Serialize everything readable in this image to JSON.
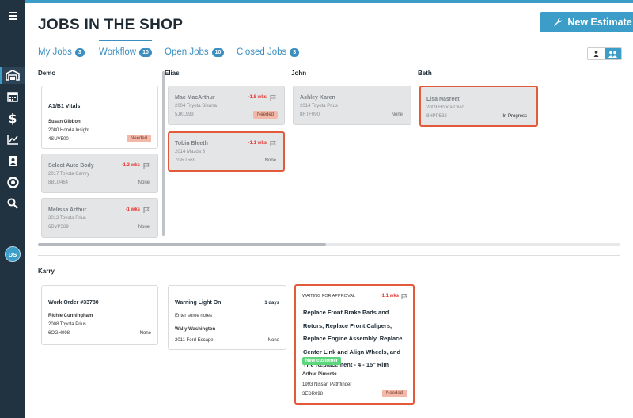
{
  "page": {
    "title": "JOBS IN THE SHOP"
  },
  "header": {
    "new_estimate_label": "New Estimate"
  },
  "tabs": [
    {
      "label": "My Jobs",
      "count": "3"
    },
    {
      "label": "Workflow",
      "count": "10"
    },
    {
      "label": "Open Jobs",
      "count": "10"
    },
    {
      "label": "Closed Jobs",
      "count": "3"
    }
  ],
  "user": {
    "initials": "DS"
  },
  "sidebar": {
    "icons": [
      "menu-icon",
      "shop-icon",
      "calendar-icon",
      "dollar-icon",
      "chart-icon",
      "contacts-icon",
      "support-icon",
      "search-icon"
    ]
  },
  "colors": {
    "accent": "#3b9dc8",
    "highlight": "#e35a3b",
    "overdue": "#e3342f",
    "needed_bg": "#f2b9a9",
    "new_customer": "#5cd67a"
  },
  "columns": [
    {
      "name": "Demo"
    },
    {
      "name": "Elias"
    },
    {
      "name": "John"
    },
    {
      "name": "Beth"
    }
  ],
  "row2": {
    "name": "Karry"
  },
  "cards": {
    "demo1": {
      "title": "A1/B1 Vitals",
      "customer": "Susan Gibbon",
      "vehicle": "2080 Honda Insight",
      "plate": "4SUV500",
      "status": "Needed"
    },
    "demo2": {
      "title": "Select Auto Body",
      "wks": "-1.3 wks",
      "vehicle": "2017 Toyota Camry",
      "plate": "8BLU464",
      "status": "None"
    },
    "demo3": {
      "title": "Melissa Arthur",
      "wks": "-1 wks",
      "vehicle": "2012 Toyota Prius",
      "plate": "6DVP589",
      "status": "None"
    },
    "elias1": {
      "title": "Mac MacArthur",
      "wks": "-1.8 wks",
      "vehicle": "2004 Toyota Sienna",
      "plate": "5JKL993",
      "status": "Needed"
    },
    "elias2": {
      "title": "Tobin Bleeth",
      "wks": "-1.1 wks",
      "vehicle": "2014 Mazda 3",
      "plate": "7GRT569",
      "status": "None"
    },
    "john1": {
      "title": "Ashley Karen",
      "vehicle": "2014 Toyota Prius",
      "plate": "8RTF090",
      "status": "None"
    },
    "beth1": {
      "title": "Lisa Nasreet",
      "vehicle": "2009 Honda Civic",
      "plate": "8HPP532",
      "status": "In Progress"
    },
    "karry1": {
      "title": "Work Order #33780",
      "customer": "Richie Cunningham",
      "vehicle": "2008 Toyota Prius",
      "plate": "6OGH098",
      "status": "None"
    },
    "karry2": {
      "title": "Warning Light On",
      "days": "1 days",
      "notes": "Enter some notes",
      "customer": "Wally Washington",
      "vehicle": "2011 Ford Escape",
      "status": "None"
    },
    "karry3": {
      "label": "WAITING FOR APPROVAL",
      "wks": "-1.1 wks",
      "title": "Replace Front Brake Pads and Rotors, Replace Front Calipers, Replace Engine Assembly, Replace Center Link and Align Wheels, and Tire Replacement - 4 - 15\" Rim",
      "tag": "New customer",
      "customer": "Arthur Pimento",
      "vehicle": "1993 Nissan Pathfinder",
      "plate": "3EDR098",
      "status": "Needed"
    }
  }
}
